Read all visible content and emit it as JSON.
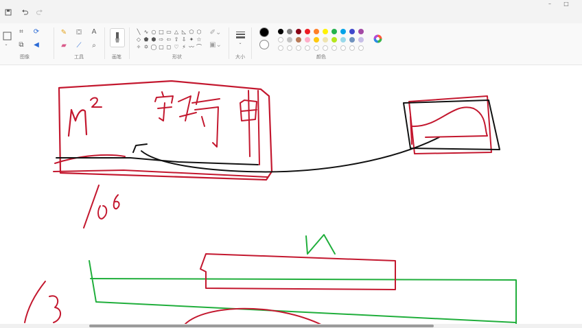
{
  "ribbon": {
    "groups": {
      "image": "图像",
      "tools": "工具",
      "brushes": "画笔",
      "shapes": "形状",
      "size": "大小",
      "colors": "颜色"
    },
    "text_tool_glyph": "A",
    "shape_glyphs": [
      "╲",
      "∿",
      "○",
      "□",
      "▭",
      "△",
      "◺",
      "⬠",
      "⬡",
      "◇",
      "⬟",
      "⬢",
      "⇨",
      "⇦",
      "⇧",
      "⇩",
      "✦",
      "☆",
      "✧",
      "✡",
      "◯",
      "▢",
      "◻",
      "♡",
      "⚡",
      "〰",
      "⌒"
    ],
    "colors_row1": [
      "#000000",
      "#7f7f7f",
      "#880015",
      "#ed1c24",
      "#ff7f27",
      "#fff200",
      "#22b14c",
      "#00a2e8",
      "#3f48cc",
      "#a349a4"
    ],
    "colors_row2": [
      "#ffffff",
      "#c3c3c3",
      "#b97a57",
      "#ffaec9",
      "#ffc90e",
      "#efe4b0",
      "#b5e61d",
      "#99d9ea",
      "#7092be",
      "#c8bfe7"
    ],
    "primary_color": "#000000",
    "secondary_color": "#ffffff"
  },
  "titlebar": {
    "minimize_glyph": "–",
    "maximize_glyph": "□"
  },
  "canvas": {
    "ink_colors": {
      "red": "#c3172e",
      "black": "#111111",
      "green": "#1fae3b"
    }
  }
}
